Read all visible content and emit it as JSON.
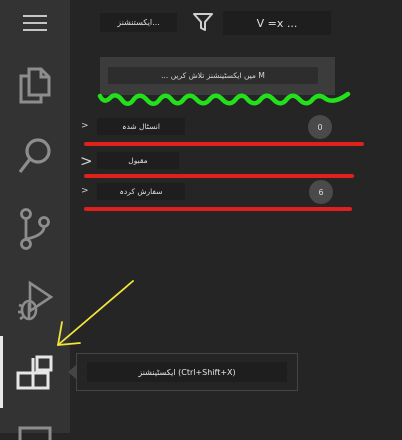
{
  "activity_bar": {
    "items": [
      {
        "icon": "menu-icon"
      },
      {
        "icon": "explorer-icon"
      },
      {
        "icon": "search-icon"
      },
      {
        "icon": "source-control-icon"
      },
      {
        "icon": "run-debug-icon"
      },
      {
        "icon": "extensions-icon"
      },
      {
        "icon": "remote-explorer-icon"
      }
    ]
  },
  "toolbar": {
    "extensions_button_label": "ایکستنشنز...",
    "filter_icon": "filter-icon",
    "view_more_label": "V =x ..."
  },
  "search": {
    "placeholder": "... میں ایکسٹینشنز تلاش کریں M"
  },
  "sections": [
    {
      "label": "انسٹال شدہ",
      "badge": "0",
      "chevron": ">"
    },
    {
      "label": "مقبول",
      "badge": "",
      "chevron": ">"
    },
    {
      "label": "سفارش کردہ",
      "badge": "6",
      "chevron": ">"
    }
  ],
  "tooltip": {
    "text": "ایکسٹینشنز (Ctrl+Shift+X)"
  },
  "colors": {
    "highlight_green": "#22e01a",
    "highlight_red": "#e0201c",
    "arrow_yellow": "#f2e43a"
  }
}
